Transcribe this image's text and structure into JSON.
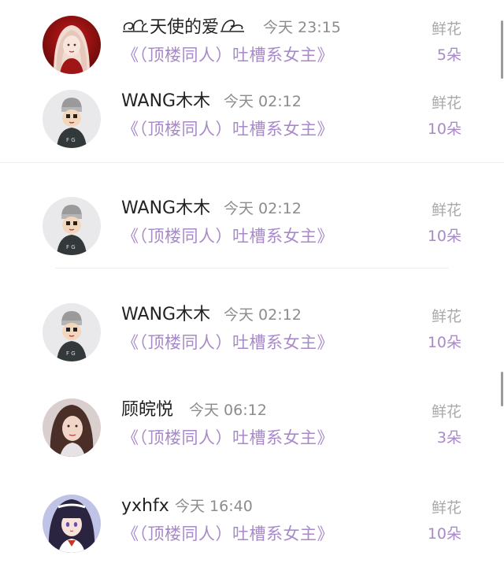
{
  "entries": [
    {
      "user_name": "天使的爱",
      "time": "今天 23:15",
      "book_title": "《（顶楼同人）吐槽系女主》",
      "gift_label": "鲜花",
      "gift_count": "5朵",
      "avatar_icon": "girl-red-avatar-icon"
    },
    {
      "user_name": "WANG木木",
      "time": "今天 02:12",
      "book_title": "《（顶楼同人）吐槽系女主》",
      "gift_label": "鲜花",
      "gift_count": "10朵",
      "avatar_icon": "cartoon-boy-avatar-icon"
    },
    {
      "user_name": "WANG木木",
      "time": "今天 02:12",
      "book_title": "《（顶楼同人）吐槽系女主》",
      "gift_label": "鲜花",
      "gift_count": "10朵",
      "avatar_icon": "cartoon-boy-avatar-icon"
    },
    {
      "user_name": "WANG木木",
      "time": "今天 02:12",
      "book_title": "《（顶楼同人）吐槽系女主》",
      "gift_label": "鲜花",
      "gift_count": "10朵",
      "avatar_icon": "cartoon-boy-avatar-icon"
    },
    {
      "user_name": "顾皖悦",
      "time": "今天 06:12",
      "book_title": "《（顶楼同人）吐槽系女主》",
      "gift_label": "鲜花",
      "gift_count": "3朵",
      "avatar_icon": "girl-photo-avatar-icon"
    },
    {
      "user_name": "yxhfx",
      "time": "今天 16:40",
      "book_title": "《（顶楼同人）吐槽系女主》",
      "gift_label": "鲜花",
      "gift_count": "10朵",
      "avatar_icon": "anime-girl-avatar-icon"
    }
  ],
  "colors": {
    "accent_purple": "#a889c9",
    "name_text": "#222222",
    "time_text": "#8c8c8c",
    "gift_label_text": "#a9a9a9"
  }
}
